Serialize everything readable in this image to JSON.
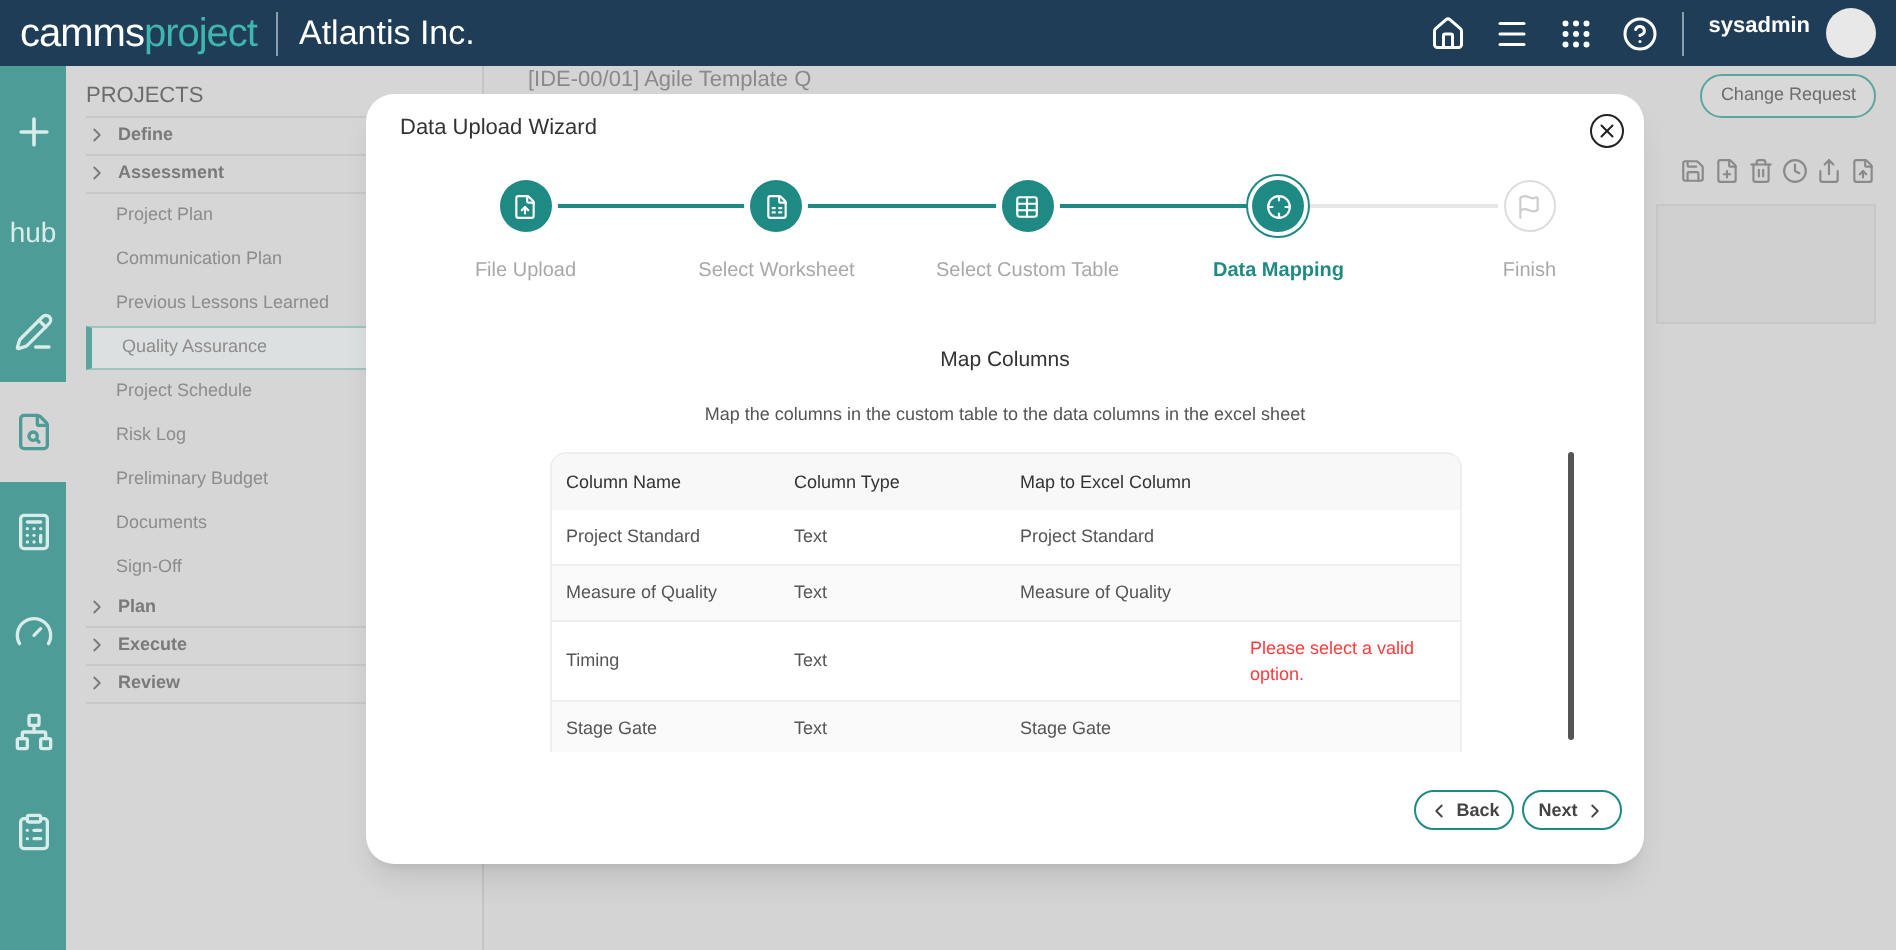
{
  "header": {
    "logo_part_1": "camms",
    "logo_part_2": "project",
    "company": "Atlantis Inc.",
    "user": "sysadmin"
  },
  "rail": {
    "items": [
      {
        "selected": false
      },
      {
        "label": "hub",
        "selected": false
      },
      {
        "selected": false
      },
      {
        "selected": true
      },
      {
        "selected": false
      },
      {
        "selected": false
      },
      {
        "selected": false
      },
      {
        "selected": false
      }
    ]
  },
  "sidebar": {
    "title": "PROJECTS",
    "groups": [
      {
        "label": "Define"
      },
      {
        "label": "Assessment",
        "children": [
          {
            "label": "Project Plan",
            "selected": false
          },
          {
            "label": "Communication Plan",
            "selected": false
          },
          {
            "label": "Previous Lessons Learned",
            "selected": false
          },
          {
            "label": "Quality Assurance",
            "selected": true
          },
          {
            "label": "Project Schedule",
            "selected": false
          },
          {
            "label": "Risk Log",
            "selected": false
          },
          {
            "label": "Preliminary Budget",
            "selected": false
          },
          {
            "label": "Documents",
            "selected": false
          },
          {
            "label": "Sign-Off",
            "selected": false
          }
        ]
      },
      {
        "label": "Plan"
      },
      {
        "label": "Execute"
      },
      {
        "label": "Review"
      }
    ]
  },
  "page": {
    "title": "[IDE-00/01] Agile Template Q",
    "change_request_button": "Change Request"
  },
  "wizard": {
    "title": "Data Upload Wizard",
    "steps": [
      {
        "label": "File Upload",
        "completed": true,
        "selected": false
      },
      {
        "label": "Select Worksheet",
        "completed": true,
        "selected": false
      },
      {
        "label": "Select Custom Table",
        "completed": true,
        "selected": false
      },
      {
        "label": "Data Mapping",
        "completed": true,
        "selected": true
      },
      {
        "label": "Finish",
        "completed": false,
        "selected": false
      }
    ],
    "section_title": "Map Columns",
    "description": "Map the columns in the custom table to the data columns in the excel sheet",
    "table": {
      "columns": [
        "Column Name",
        "Column Type",
        "Map to Excel Column"
      ],
      "rows": [
        {
          "column_name": "Project Standard",
          "column_type": "Text",
          "mapping": "Project Standard"
        },
        {
          "column_name": "Measure of Quality",
          "column_type": "Text",
          "mapping": "Measure of Quality"
        },
        {
          "column_name": "Timing",
          "column_type": "Text",
          "error": "Please select a valid option."
        },
        {
          "column_name": "Stage Gate",
          "column_type": "Text",
          "mapping": "Stage Gate"
        }
      ]
    },
    "buttons": {
      "back": "Back",
      "next": "Next"
    }
  }
}
